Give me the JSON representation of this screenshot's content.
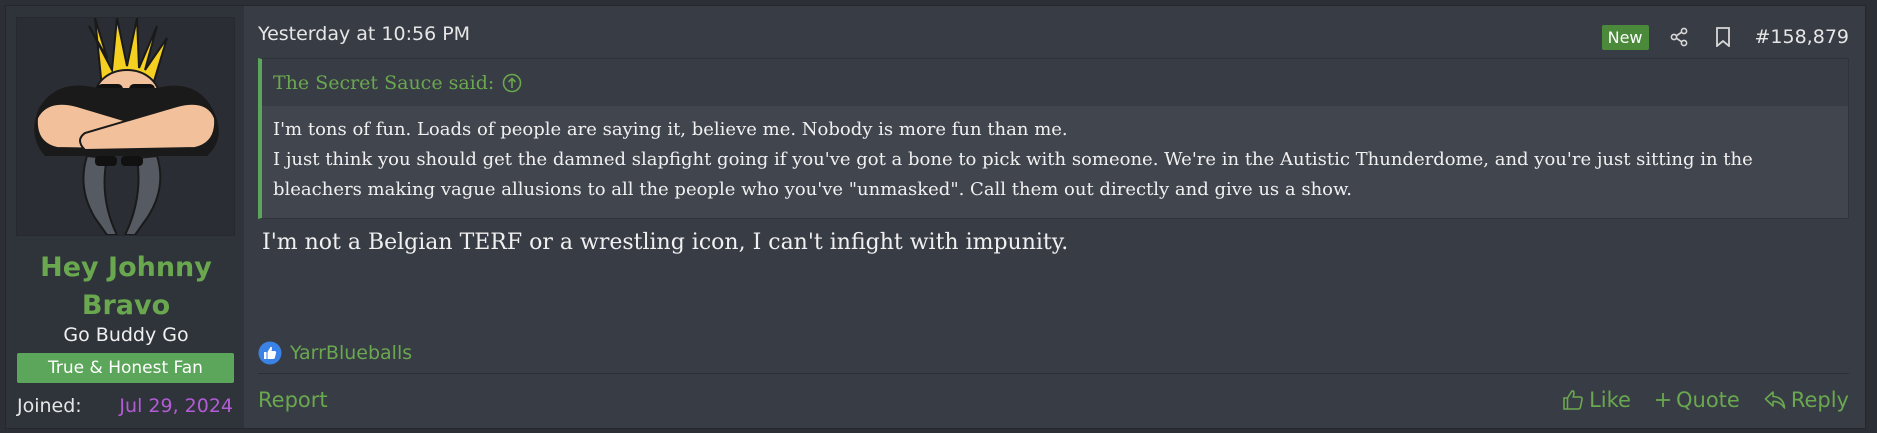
{
  "user": {
    "name": "Hey Johnny Bravo",
    "title": "Go Buddy Go",
    "banner": "True & Honest Fan",
    "joined_label": "Joined:",
    "joined_value": "Jul 29, 2024"
  },
  "post": {
    "date": "Yesterday at 10:56 PM",
    "badge": "New",
    "number": "#158,879",
    "quote": {
      "author": "The Secret Sauce said:",
      "lines": [
        "I'm tons of fun. Loads of people are saying it, believe me. Nobody is more fun than me.",
        "I just think you should get the damned slapfight going if you've got a bone to pick with someone. We're in the Autistic Thunderdome, and you're just sitting in the",
        "bleachers making vague allusions to all the people who you've \"unmasked\". Call them out directly and give us a show."
      ]
    },
    "message": "I'm not a Belgian TERF or a wrestling icon, I can't infight with impunity.",
    "reactor": "YarrBlueballs"
  },
  "footer": {
    "report": "Report",
    "like": "Like",
    "quote": "Quote",
    "reply": "Reply"
  },
  "colors": {
    "accent_green": "#6aa84f",
    "banner_green": "#5ca65c",
    "joined_purple": "#b35cd6",
    "post_bg": "#383c45",
    "quote_bg": "#41454e"
  },
  "icons": [
    "share-icon",
    "bookmark-icon",
    "arrow-up-circle-icon",
    "like-reaction-icon",
    "thumbs-up-icon",
    "plus-icon",
    "reply-icon"
  ]
}
